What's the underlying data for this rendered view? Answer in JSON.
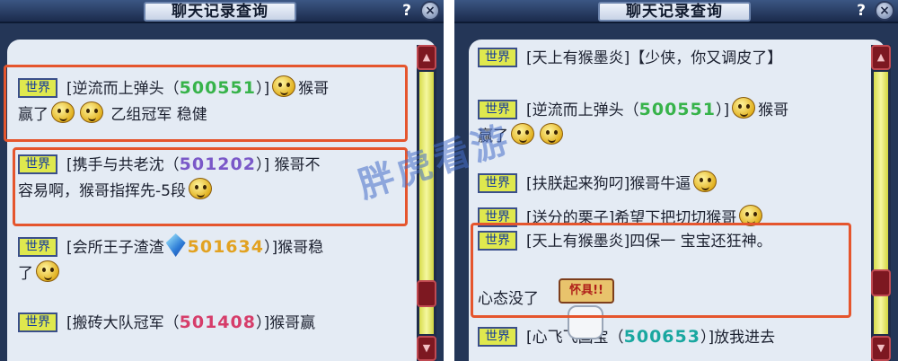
{
  "left_window": {
    "title": "聊天记录查询",
    "help_label": "?",
    "close_label": "×",
    "messages": [
      {
        "channel": "世界",
        "sender_prefix": "[逆流而上弹头（",
        "sender_id": "500551",
        "sender_suffix": "）]",
        "text_a": "猴哥",
        "text_b": "赢了",
        "text_c": "乙组冠军 稳健"
      },
      {
        "channel": "世界",
        "sender_prefix": "[携手与共老沈（",
        "sender_id": "501202",
        "sender_suffix": "）]",
        "text_a": "猴哥不",
        "text_b": "容易啊，猴哥指挥先-5段"
      },
      {
        "channel": "世界",
        "sender_prefix": "[会所王子渣渣",
        "sender_id": "501634",
        "sender_suffix": "）]",
        "text_a": "猴哥稳",
        "text_b": "了"
      },
      {
        "channel": "世界",
        "sender_prefix": "[搬砖大队冠军（",
        "sender_id": "501408",
        "sender_suffix": "）]",
        "text_a": "猴哥赢"
      }
    ]
  },
  "right_window": {
    "title": "聊天记录查询",
    "help_label": "?",
    "close_label": "×",
    "messages": [
      {
        "channel": "世界",
        "sender": "[天上有猴墨炎]",
        "text": "【少侠，你又调皮了】"
      },
      {
        "channel": "世界",
        "sender_prefix": "[逆流而上弹头（",
        "sender_id": "500551",
        "sender_suffix": "）]",
        "text_a": "猴哥",
        "text_b": "赢了"
      },
      {
        "channel": "世界",
        "sender": "[扶朕起来狗叼]",
        "text": "猴哥牛逼"
      },
      {
        "channel": "世界",
        "sender": "[送分的栗子]",
        "text": "希望下把切切猴哥"
      },
      {
        "channel": "世界",
        "sender": "[天上有猴墨炎]",
        "text": "四保一  宝宝还狂神。",
        "text_b": "心态没了"
      },
      {
        "channel": "世界",
        "sender_prefix": "[心飞飞国宝（",
        "sender_id": "500653",
        "sender_suffix": "）]",
        "text_a": "放我进去"
      }
    ],
    "sticker_label": "怀具!!"
  },
  "watermark": "胖虎看游",
  "colors": {
    "window_bg": "#243657",
    "chat_bg": "#e4ebf4",
    "highlight": "#e5552d",
    "badge_bg": "#dfe84e"
  }
}
